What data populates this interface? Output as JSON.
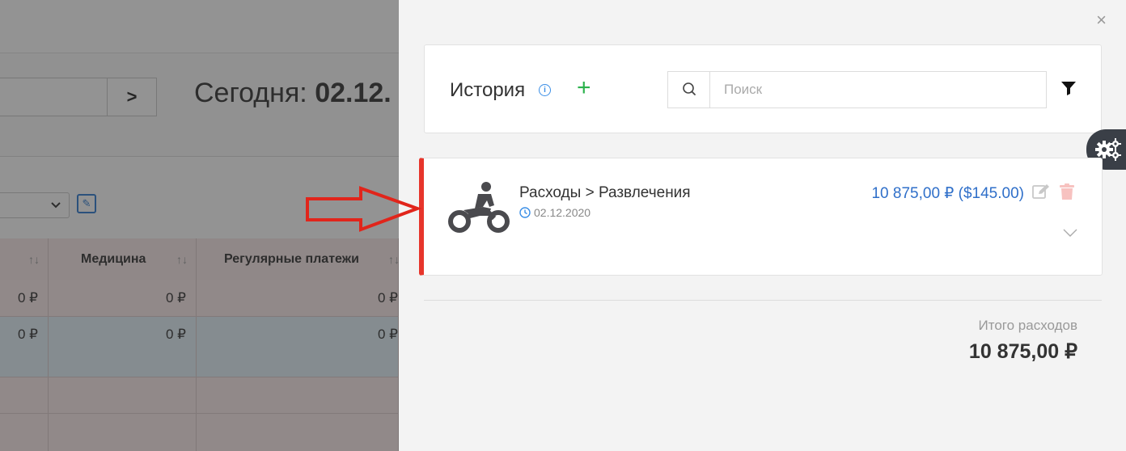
{
  "background": {
    "date_input_value": "",
    "next_button_label": ">",
    "today_prefix": "Сегодня: ",
    "today_date": "02.12.",
    "table": {
      "columns": [
        {
          "label": "",
          "sort": "↑↓"
        },
        {
          "label": "Медицина",
          "sort": "↑↓"
        },
        {
          "label": "Регулярные платежи",
          "sort": "↑↓"
        }
      ],
      "rows": [
        [
          "0 ₽",
          "0 ₽",
          "0 ₽"
        ],
        [
          "0 ₽",
          "0 ₽",
          "0 ₽"
        ],
        [
          "",
          "",
          ""
        ],
        [
          "",
          "",
          ""
        ]
      ]
    }
  },
  "panel": {
    "close_label": "×",
    "history": {
      "title": "История",
      "info_symbol": "i",
      "add_symbol": "+",
      "search_placeholder": "Поиск"
    },
    "record": {
      "category": "Расходы > Развлечения",
      "date": "02.12.2020",
      "amount": "10 875,00 ₽ ($145.00)",
      "icon": "motorcycle-icon",
      "accent_color": "#e7352b"
    },
    "totals": {
      "label": "Итого расходов",
      "value": "10 875,00 ₽"
    }
  },
  "colors": {
    "amount": "#2f6fc9",
    "add": "#2bb24c",
    "annotation_arrow": "#e1251b"
  }
}
